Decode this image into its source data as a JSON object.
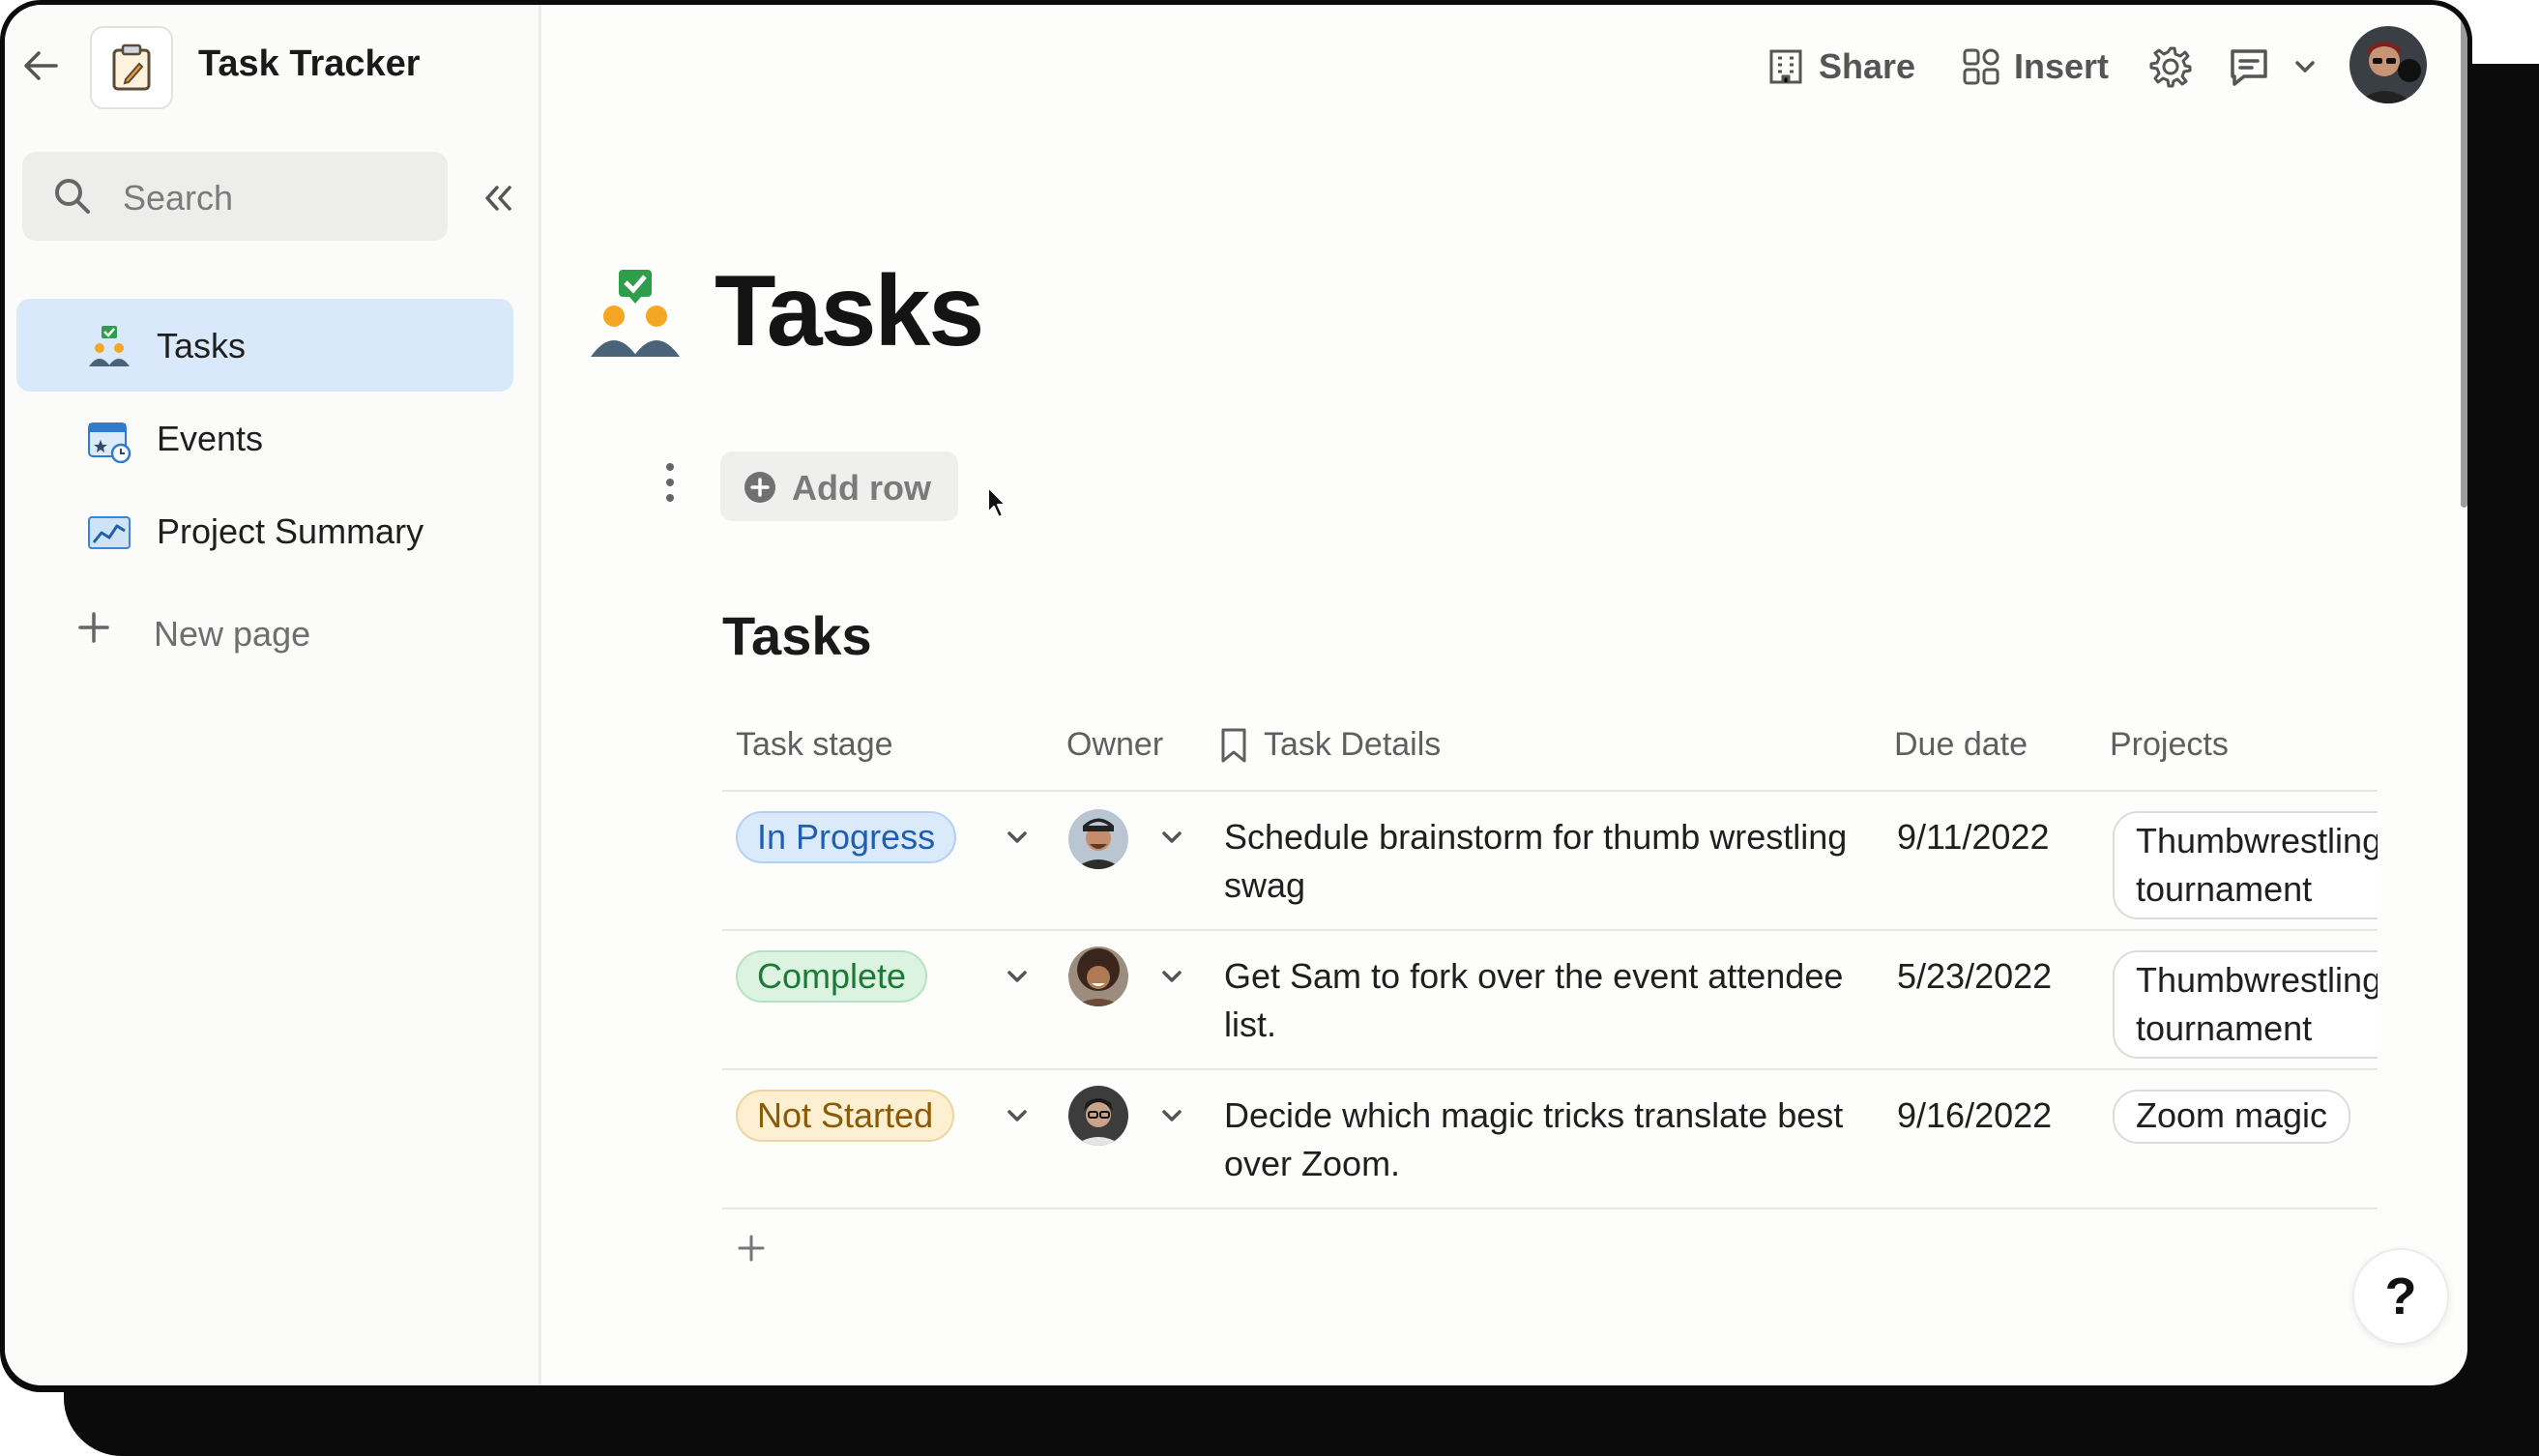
{
  "app": {
    "doc_title": "Task Tracker"
  },
  "sidebar": {
    "search_placeholder": "Search",
    "items": [
      {
        "label": "Tasks",
        "icon": "people-check-icon",
        "active": true
      },
      {
        "label": "Events",
        "icon": "calendar-clock-icon",
        "active": false
      },
      {
        "label": "Project Summary",
        "icon": "chart-icon",
        "active": false
      }
    ],
    "new_page_label": "New page"
  },
  "toolbar": {
    "share_label": "Share",
    "insert_label": "Insert"
  },
  "page": {
    "title": "Tasks",
    "add_row_label": "Add row"
  },
  "table": {
    "title": "Tasks",
    "columns": [
      "Task stage",
      "Owner",
      "Task Details",
      "Due date",
      "Projects"
    ],
    "rows": [
      {
        "stage": "In Progress",
        "details": "Schedule brainstorm for thumb wrestling swag",
        "due": "9/11/2022",
        "project": "Thumbwrestling tournament"
      },
      {
        "stage": "Complete",
        "details": "Get Sam to fork over the event attendee list.",
        "due": "5/23/2022",
        "project": "Thumbwrestling tournament"
      },
      {
        "stage": "Not Started",
        "details": "Decide which magic tricks translate best over Zoom.",
        "due": "9/16/2022",
        "project": "Zoom magic"
      }
    ]
  },
  "help": {
    "label": "?"
  },
  "colors": {
    "active_nav_bg": "#d9e9fb",
    "in_progress": "#1d5fb6",
    "complete": "#1c7a36",
    "not_started": "#8a5a06"
  }
}
